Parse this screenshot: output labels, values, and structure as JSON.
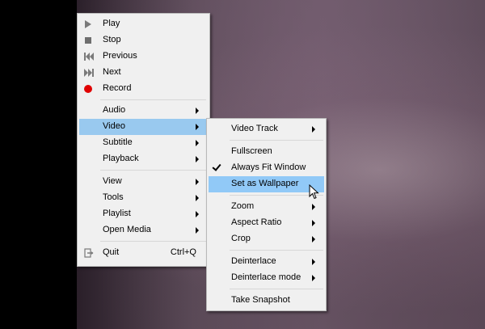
{
  "main_menu": {
    "items": [
      {
        "label": "Play",
        "icon": "play-icon"
      },
      {
        "label": "Stop",
        "icon": "stop-icon"
      },
      {
        "label": "Previous",
        "icon": "previous-icon"
      },
      {
        "label": "Next",
        "icon": "next-icon"
      },
      {
        "label": "Record",
        "icon": "record-icon"
      },
      {
        "label": "Audio"
      },
      {
        "label": "Video"
      },
      {
        "label": "Subtitle"
      },
      {
        "label": "Playback"
      },
      {
        "label": "View"
      },
      {
        "label": "Tools"
      },
      {
        "label": "Playlist"
      },
      {
        "label": "Open Media"
      },
      {
        "label": "Quit",
        "shortcut": "Ctrl+Q",
        "icon": "quit-icon"
      }
    ]
  },
  "video_submenu": {
    "items": [
      {
        "label": "Video Track"
      },
      {
        "label": "Fullscreen"
      },
      {
        "label": "Always Fit Window",
        "checked": true
      },
      {
        "label": "Set as Wallpaper"
      },
      {
        "label": "Zoom"
      },
      {
        "label": "Aspect Ratio"
      },
      {
        "label": "Crop"
      },
      {
        "label": "Deinterlace"
      },
      {
        "label": "Deinterlace mode"
      },
      {
        "label": "Take Snapshot"
      }
    ]
  },
  "colors": {
    "menu_bg": "#f0f0f0",
    "highlight": "#99c9ef",
    "record": "#e00000"
  }
}
